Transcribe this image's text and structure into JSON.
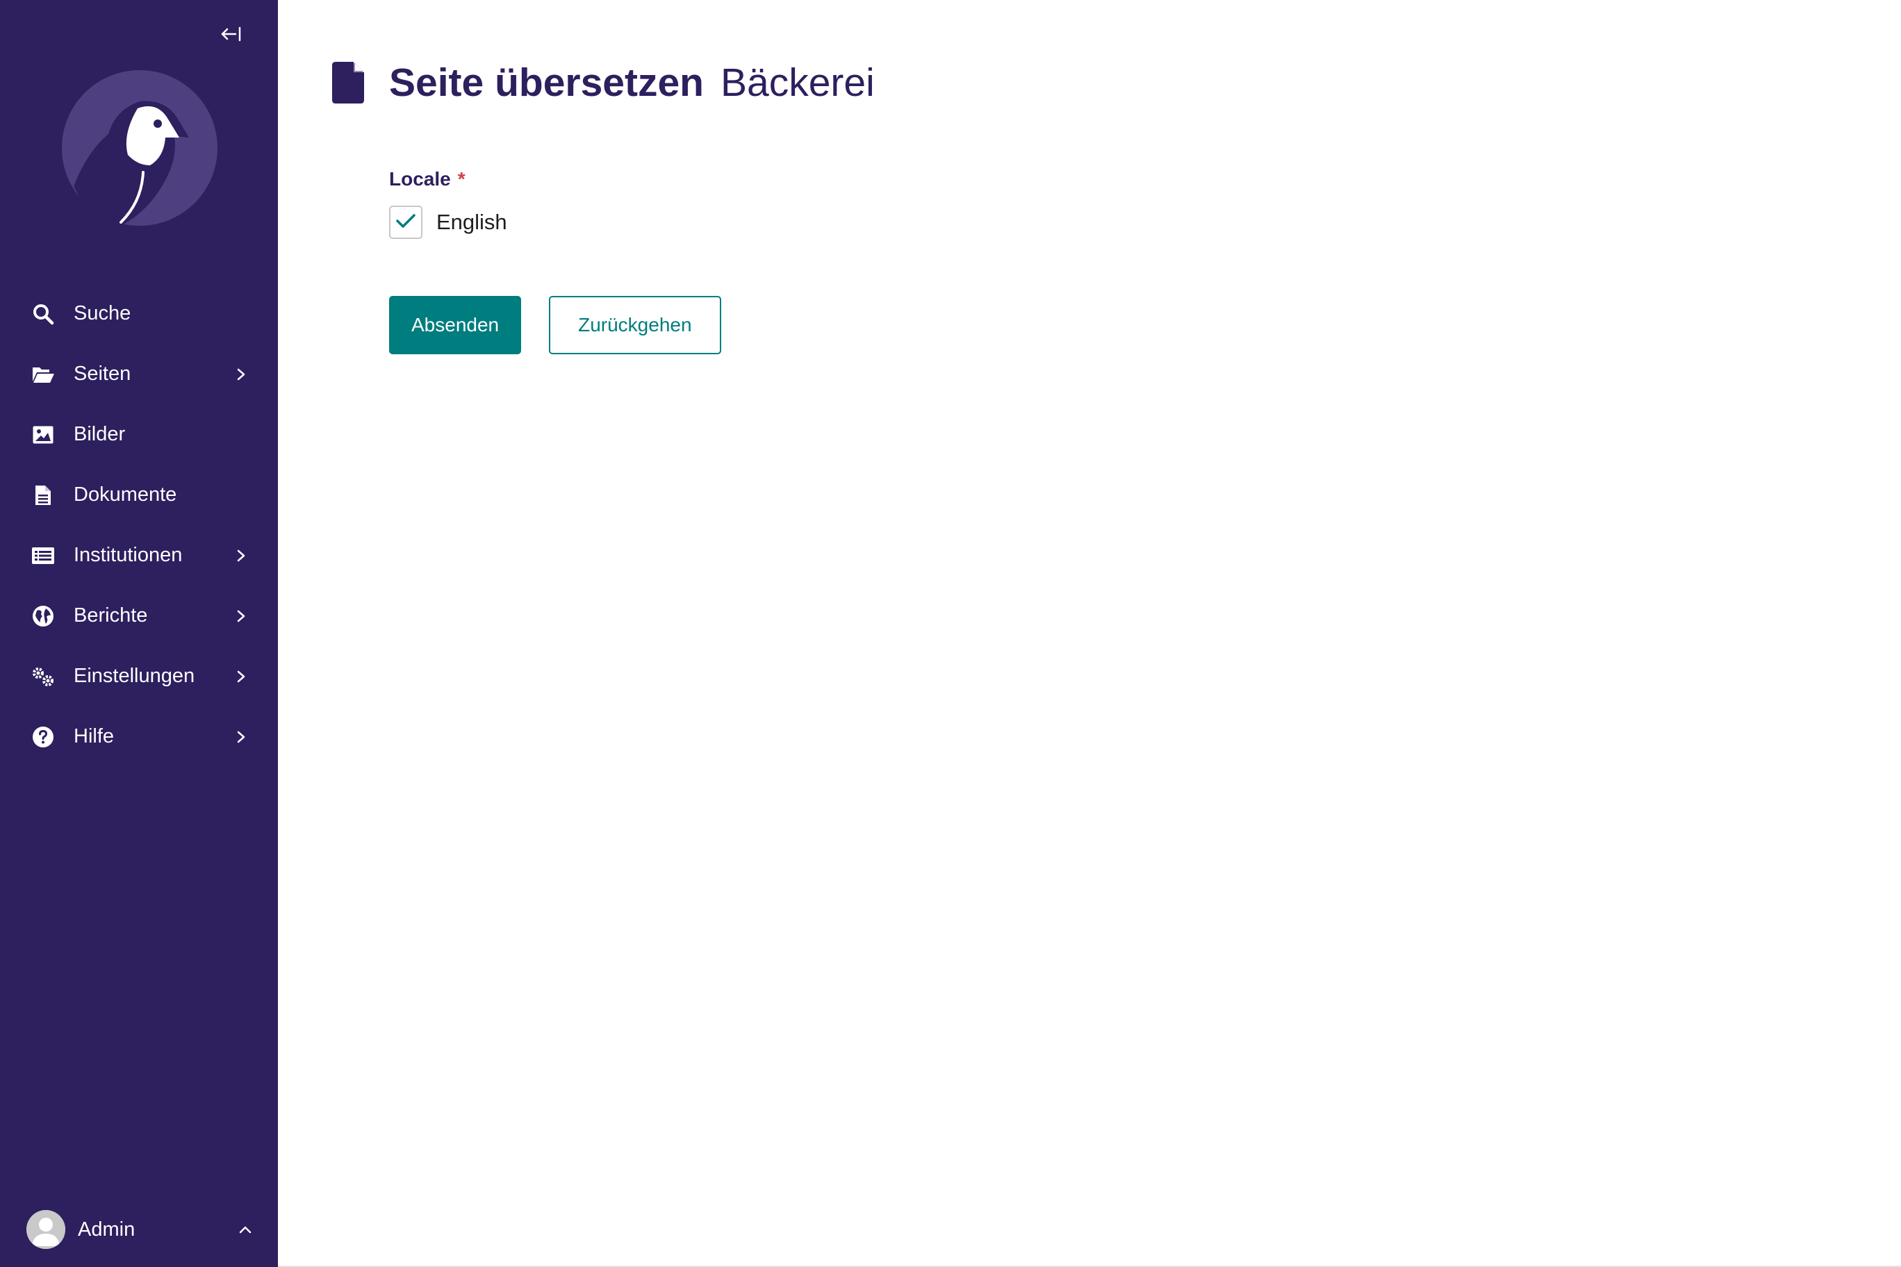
{
  "colors": {
    "sidebar_bg": "#2e1f5e",
    "accent": "#007d7e",
    "title_color": "#2e1f5e",
    "required": "#cd4444"
  },
  "sidebar": {
    "collapse_icon": "collapse-left-icon",
    "logo": "wagtail-bird-logo",
    "items": [
      {
        "label": "Suche",
        "icon": "search-icon",
        "has_submenu": false
      },
      {
        "label": "Seiten",
        "icon": "folder-open-icon",
        "has_submenu": true
      },
      {
        "label": "Bilder",
        "icon": "image-icon",
        "has_submenu": false
      },
      {
        "label": "Dokumente",
        "icon": "document-icon",
        "has_submenu": false
      },
      {
        "label": "Institutionen",
        "icon": "list-icon",
        "has_submenu": true
      },
      {
        "label": "Berichte",
        "icon": "globe-icon",
        "has_submenu": true
      },
      {
        "label": "Einstellungen",
        "icon": "cogs-icon",
        "has_submenu": true
      },
      {
        "label": "Hilfe",
        "icon": "help-icon",
        "has_submenu": true
      }
    ],
    "account": {
      "label": "Admin",
      "icon": "avatar-icon"
    }
  },
  "header": {
    "icon": "page-icon",
    "title": "Seite übersetzen",
    "subtitle": "Bäckerei"
  },
  "form": {
    "field_label": "Locale",
    "required_mark": "*",
    "options": [
      {
        "label": "English",
        "checked": true
      }
    ]
  },
  "actions": {
    "submit_label": "Absenden",
    "back_label": "Zurückgehen"
  }
}
